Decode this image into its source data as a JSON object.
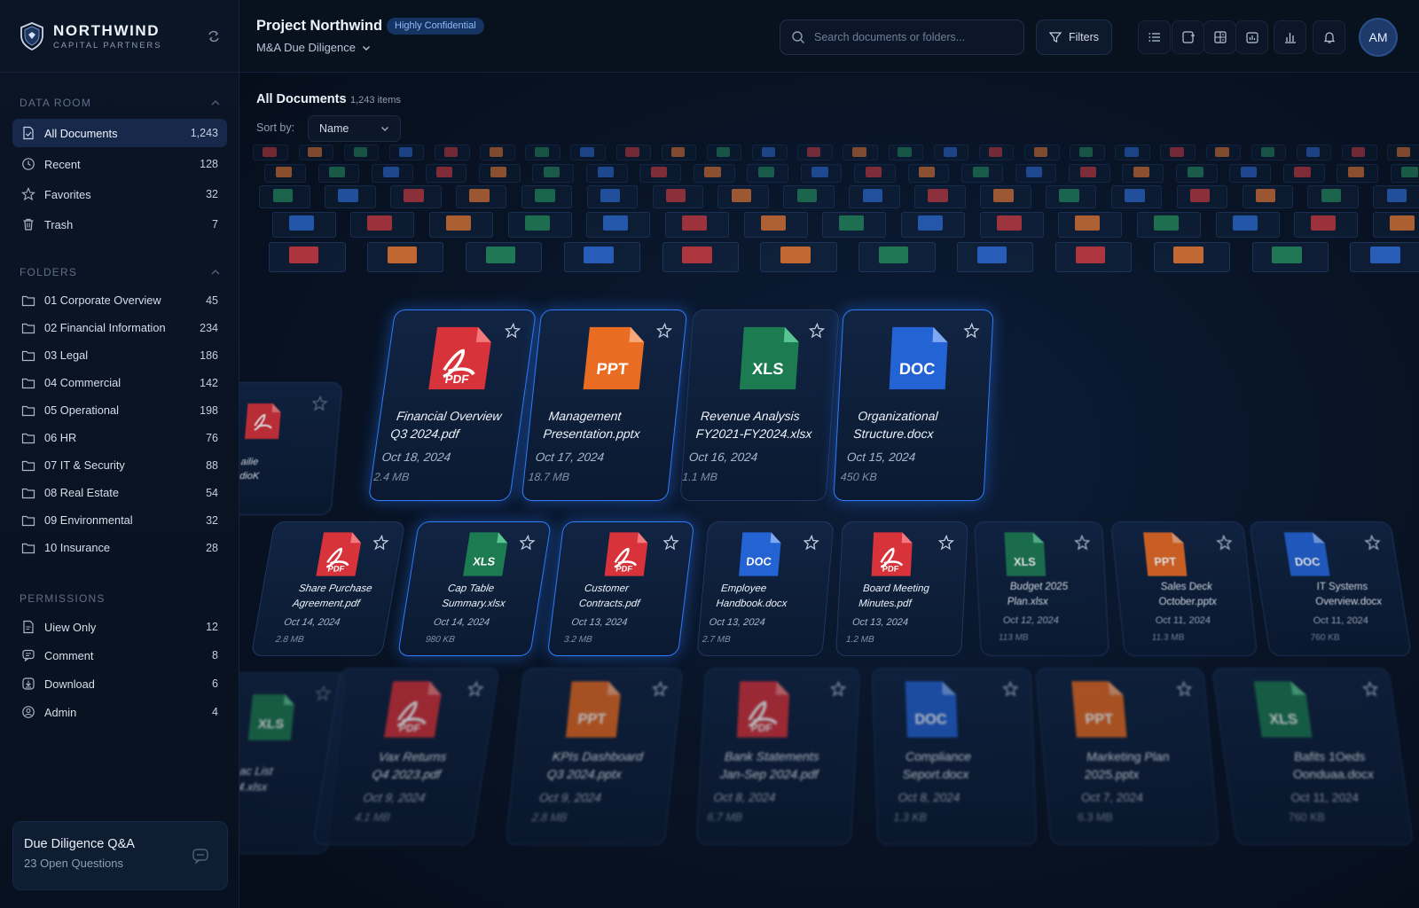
{
  "brand": {
    "name": "NORTHWIND",
    "sub": "CAPITAL PARTNERS"
  },
  "sidebar": {
    "data_room": {
      "title": "DATA ROOM",
      "items": [
        {
          "label": "All Documents",
          "count": "1,243",
          "icon": "document-icon"
        },
        {
          "label": "Recent",
          "count": "128",
          "icon": "clock-icon"
        },
        {
          "label": "Favorites",
          "count": "32",
          "icon": "star-icon"
        },
        {
          "label": "Trash",
          "count": "7",
          "icon": "trash-icon"
        }
      ]
    },
    "folders": {
      "title": "FOLDERS",
      "items": [
        {
          "label": "01 Corporate Overview",
          "count": "45"
        },
        {
          "label": "02 Financial Information",
          "count": "234"
        },
        {
          "label": "03 Legal",
          "count": "186"
        },
        {
          "label": "04 Commercial",
          "count": "142"
        },
        {
          "label": "05 Operational",
          "count": "198"
        },
        {
          "label": "06 HR",
          "count": "76"
        },
        {
          "label": "07 IT & Security",
          "count": "88"
        },
        {
          "label": "08 Real Estate",
          "count": "54"
        },
        {
          "label": "09 Environmental",
          "count": "32"
        },
        {
          "label": "10 Insurance",
          "count": "28"
        }
      ]
    },
    "permissions": {
      "title": "PERMISSIONS",
      "items": [
        {
          "label": "Uiew Only",
          "count": "12",
          "icon": "view-doc-icon"
        },
        {
          "label": "Comment",
          "count": "8",
          "icon": "comment-icon"
        },
        {
          "label": "Download",
          "count": "6",
          "icon": "download-icon"
        },
        {
          "label": "Admin",
          "count": "4",
          "icon": "admin-icon"
        }
      ]
    },
    "qa": {
      "title": "Due Diligence Q&A",
      "sub": "23 Open Questions"
    }
  },
  "header": {
    "project": "Project Northwind",
    "badge": "Highly Confidential",
    "subtitle": "M&A Due Diligence",
    "search_placeholder": "Search documents or folders...",
    "filters_label": "Filters",
    "avatar_initials": "AM"
  },
  "main": {
    "title": "All Documents",
    "count": "1,243 items",
    "sort_label": "Sort by:",
    "sort_value": "Name"
  },
  "colors": {
    "pdf": "#e0363c",
    "ppt": "#f07a2a",
    "xls": "#1f8f5c",
    "doc": "#2d73e0",
    "accent": "#2f7dff"
  },
  "cards_row1": [
    {
      "name1": "Financial Overview",
      "name2": "Q3 2024.pdf",
      "date": "Oct 18, 2024",
      "size": "2.4 MB",
      "type": "PDF"
    },
    {
      "name1": "Management",
      "name2": "Presentation.pptx",
      "date": "Oct 17, 2024",
      "size": "18.7 MB",
      "type": "PPT"
    },
    {
      "name1": "Revenue Analysis",
      "name2": "FY2021-FY2024.xlsx",
      "date": "Oct 16, 2024",
      "size": "1.1 MB",
      "type": "XLS"
    },
    {
      "name1": "Organizational",
      "name2": "Structure.docx",
      "date": "Oct 15, 2024",
      "size": "450 KB",
      "type": "DOC"
    }
  ],
  "cards_row2": [
    {
      "name1": "Share Purchase",
      "name2": "Agreement.pdf",
      "date": "Oct 14, 2024",
      "size": "2.8 MB",
      "type": "PDF"
    },
    {
      "name1": "Cap Table",
      "name2": "Summary.xlsx",
      "date": "Oct 14, 2024",
      "size": "980 KB",
      "type": "XLS"
    },
    {
      "name1": "Customer",
      "name2": "Contracts.pdf",
      "date": "Oct 13, 2024",
      "size": "3.2 MB",
      "type": "PDF"
    },
    {
      "name1": "Employee",
      "name2": "Handbook.docx",
      "date": "Oct 13, 2024",
      "size": "2.7 MB",
      "type": "DOC"
    },
    {
      "name1": "Board Meeting",
      "name2": "Minutes.pdf",
      "date": "Oct 13, 2024",
      "size": "1.2 MB",
      "type": "PDF"
    },
    {
      "name1": "Budget 2025",
      "name2": "Plan.xlsx",
      "date": "Oct 12, 2024",
      "size": "113 MB",
      "type": "XLS"
    },
    {
      "name1": "Sales Deck",
      "name2": "October.pptx",
      "date": "Oct 11, 2024",
      "size": "11.3 MB",
      "type": "PPT"
    },
    {
      "name1": "IT Systems",
      "name2": "Overview.docx",
      "date": "Oct 11, 2024",
      "size": "760 KB",
      "type": "DOC"
    }
  ],
  "cards_row3": [
    {
      "name1": "Vax Returns",
      "name2": "Q4 2023.pdf",
      "date": "Oct 9, 2024",
      "size": "4.1 MB",
      "type": "PDF"
    },
    {
      "name1": "KPIs Dashboard",
      "name2": "Q3 2024.pptx",
      "date": "Oct 9, 2024",
      "size": "2.8 MB",
      "type": "PPT"
    },
    {
      "name1": "Bank Statements",
      "name2": "Jan-Sep 2024.pdf",
      "date": "Oct 8, 2024",
      "size": "6.7 MB",
      "type": "PDF"
    },
    {
      "name1": "Compliance",
      "name2": "Seport.docx",
      "date": "Oct 8, 2024",
      "size": "1.3 KB",
      "type": "DOC"
    },
    {
      "name1": "Marketing Plan",
      "name2": "2025.pptx",
      "date": "Oct 7, 2024",
      "size": "6.3 MB",
      "type": "PPT"
    },
    {
      "name1": "Bafits 1Oeds",
      "name2": "Oonduaa.docx",
      "date": "Oct 11, 2024",
      "size": "760 KB",
      "type": "XLS"
    }
  ],
  "partial_cards": [
    {
      "name1": "ailie",
      "name2": "dioK",
      "type": "PDF"
    },
    {
      "name1": "ac List",
      "name2": "4.xlsx",
      "type": "XLS"
    }
  ]
}
